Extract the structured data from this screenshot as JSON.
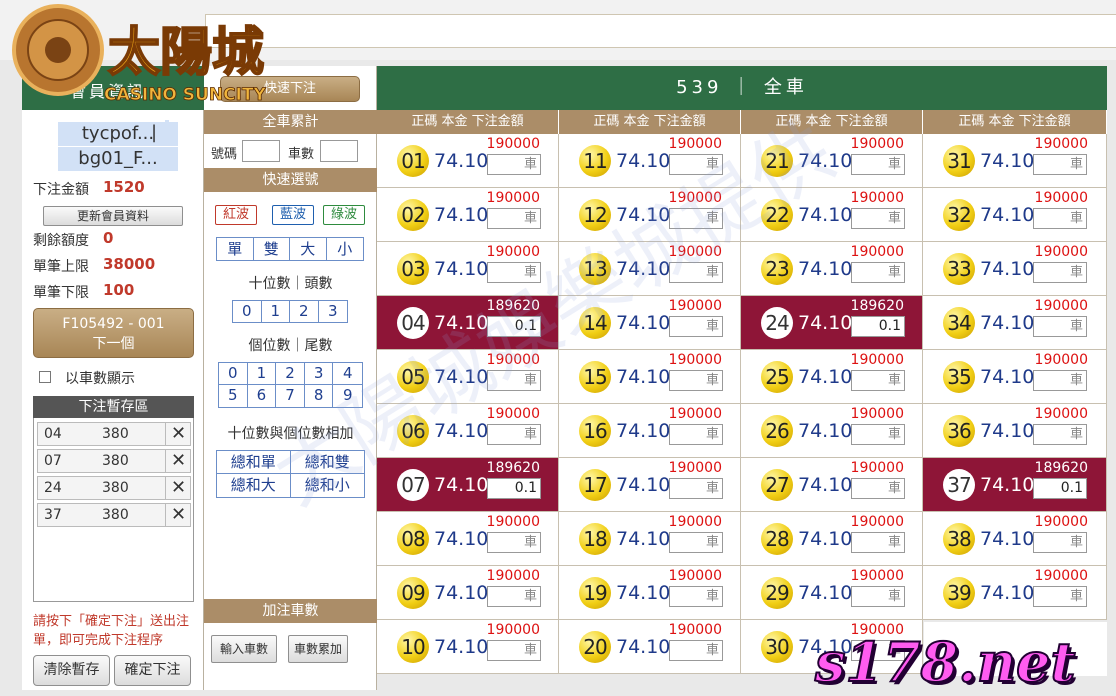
{
  "left": {
    "header": "會員資訊",
    "username": "tycpof...",
    "account": "bg01_F...",
    "separator": "|",
    "bet_total_label": "下注金額",
    "bet_total_value": "1520",
    "refresh_button": "更新會員資料",
    "remaining_label": "剩餘額度",
    "remaining_value": "0",
    "max_label": "單筆上限",
    "max_value": "38000",
    "min_label": "單筆下限",
    "min_value": "100",
    "order_line1": "F105492 - 001",
    "order_line2": "下一個",
    "show_by_car": "以車數顯示",
    "temp_header": "下注暫存區",
    "temp_rows": [
      {
        "num": "04",
        "amount": "380"
      },
      {
        "num": "07",
        "amount": "380"
      },
      {
        "num": "24",
        "amount": "380"
      },
      {
        "num": "37",
        "amount": "380"
      }
    ],
    "remove_icon": "✕",
    "note": "請按下「確定下注」送出注單，即可完成下注程序",
    "clear_button": "清除暫存",
    "confirm_button": "確定下注"
  },
  "mid": {
    "quick_bet_button": "快速下注",
    "total_header": "全車累計",
    "num_label": "號碼",
    "car_label": "車數",
    "quick_select_header": "快速選號",
    "colors": [
      "紅波",
      "藍波",
      "綠波"
    ],
    "color_hex": [
      "#c0392b",
      "#1f5fae",
      "#2e8b3e"
    ],
    "parity": [
      "單",
      "雙",
      "大",
      "小"
    ],
    "tens_caption": "十位數｜頭數",
    "tens": [
      "0",
      "1",
      "2",
      "3"
    ],
    "units_caption": "個位數｜尾數",
    "units_row1": [
      "0",
      "1",
      "2",
      "3",
      "4"
    ],
    "units_row2": [
      "5",
      "6",
      "7",
      "8",
      "9"
    ],
    "sum_caption": "十位數與個位數相加",
    "sum_row1": [
      "總和單",
      "總和雙"
    ],
    "sum_row2": [
      "總和大",
      "總和小"
    ],
    "add_car_header": "加注車數",
    "input_car_button": "輸入車數",
    "accumulate_button": "車數累加"
  },
  "main": {
    "title": "539 ｜ 全車",
    "col_header": "正碼  本金  下注金額",
    "car_placeholder": "車",
    "numbers": [
      {
        "n": "01",
        "rate": "74.10",
        "limit": "190000",
        "amount": ""
      },
      {
        "n": "02",
        "rate": "74.10",
        "limit": "190000",
        "amount": ""
      },
      {
        "n": "03",
        "rate": "74.10",
        "limit": "190000",
        "amount": ""
      },
      {
        "n": "04",
        "rate": "74.10",
        "limit": "189620",
        "amount": "0.1",
        "selected": true
      },
      {
        "n": "05",
        "rate": "74.10",
        "limit": "190000",
        "amount": ""
      },
      {
        "n": "06",
        "rate": "74.10",
        "limit": "190000",
        "amount": ""
      },
      {
        "n": "07",
        "rate": "74.10",
        "limit": "189620",
        "amount": "0.1",
        "selected": true
      },
      {
        "n": "08",
        "rate": "74.10",
        "limit": "190000",
        "amount": ""
      },
      {
        "n": "09",
        "rate": "74.10",
        "limit": "190000",
        "amount": ""
      },
      {
        "n": "10",
        "rate": "74.10",
        "limit": "190000",
        "amount": ""
      },
      {
        "n": "11",
        "rate": "74.10",
        "limit": "190000",
        "amount": ""
      },
      {
        "n": "12",
        "rate": "74.10",
        "limit": "190000",
        "amount": ""
      },
      {
        "n": "13",
        "rate": "74.10",
        "limit": "190000",
        "amount": ""
      },
      {
        "n": "14",
        "rate": "74.10",
        "limit": "190000",
        "amount": ""
      },
      {
        "n": "15",
        "rate": "74.10",
        "limit": "190000",
        "amount": ""
      },
      {
        "n": "16",
        "rate": "74.10",
        "limit": "190000",
        "amount": ""
      },
      {
        "n": "17",
        "rate": "74.10",
        "limit": "190000",
        "amount": ""
      },
      {
        "n": "18",
        "rate": "74.10",
        "limit": "190000",
        "amount": ""
      },
      {
        "n": "19",
        "rate": "74.10",
        "limit": "190000",
        "amount": ""
      },
      {
        "n": "20",
        "rate": "74.10",
        "limit": "190000",
        "amount": ""
      },
      {
        "n": "21",
        "rate": "74.10",
        "limit": "190000",
        "amount": ""
      },
      {
        "n": "22",
        "rate": "74.10",
        "limit": "190000",
        "amount": ""
      },
      {
        "n": "23",
        "rate": "74.10",
        "limit": "190000",
        "amount": ""
      },
      {
        "n": "24",
        "rate": "74.10",
        "limit": "189620",
        "amount": "0.1",
        "selected": true
      },
      {
        "n": "25",
        "rate": "74.10",
        "limit": "190000",
        "amount": ""
      },
      {
        "n": "26",
        "rate": "74.10",
        "limit": "190000",
        "amount": ""
      },
      {
        "n": "27",
        "rate": "74.10",
        "limit": "190000",
        "amount": ""
      },
      {
        "n": "28",
        "rate": "74.10",
        "limit": "190000",
        "amount": ""
      },
      {
        "n": "29",
        "rate": "74.10",
        "limit": "190000",
        "amount": ""
      },
      {
        "n": "30",
        "rate": "74.10",
        "limit": "190000",
        "amount": ""
      },
      {
        "n": "31",
        "rate": "74.10",
        "limit": "190000",
        "amount": ""
      },
      {
        "n": "32",
        "rate": "74.10",
        "limit": "190000",
        "amount": ""
      },
      {
        "n": "33",
        "rate": "74.10",
        "limit": "190000",
        "amount": ""
      },
      {
        "n": "34",
        "rate": "74.10",
        "limit": "190000",
        "amount": ""
      },
      {
        "n": "35",
        "rate": "74.10",
        "limit": "190000",
        "amount": ""
      },
      {
        "n": "36",
        "rate": "74.10",
        "limit": "190000",
        "amount": ""
      },
      {
        "n": "37",
        "rate": "74.10",
        "limit": "189620",
        "amount": "0.1",
        "selected": true
      },
      {
        "n": "38",
        "rate": "74.10",
        "limit": "190000",
        "amount": ""
      },
      {
        "n": "39",
        "rate": "74.10",
        "limit": "190000",
        "amount": ""
      }
    ]
  },
  "branding": {
    "logo_text": "太陽城",
    "logo_sub": "CASINO SUNCITY",
    "watermark": "太陽城娛樂城提供",
    "site_badge": "s178.net"
  }
}
